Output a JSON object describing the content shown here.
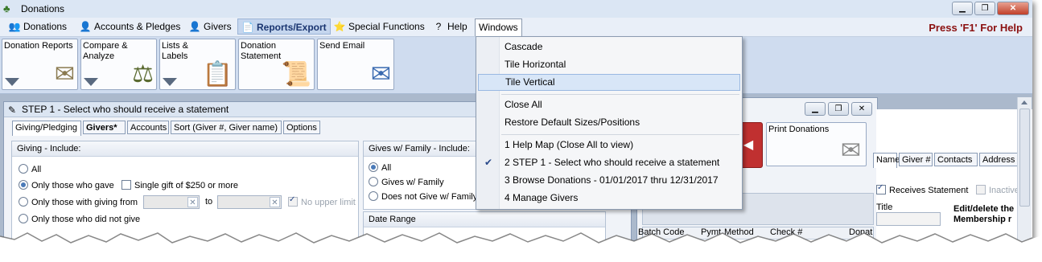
{
  "window": {
    "title": "Donations",
    "buttons": [
      "▁",
      "❐",
      "✕"
    ]
  },
  "menubar": {
    "items": [
      {
        "label": "Donations",
        "icon": "👥"
      },
      {
        "label": "Accounts & Pledges",
        "icon": "👤"
      },
      {
        "label": "Givers",
        "icon": "👤"
      },
      {
        "label": "Reports/Export",
        "icon": "📄"
      },
      {
        "label": "Special Functions",
        "icon": "⭐"
      },
      {
        "label": "Help",
        "icon": "?"
      },
      {
        "label": "Windows",
        "icon": ""
      }
    ],
    "help_hint": "Press 'F1' For Help"
  },
  "toolbar": {
    "buttons": [
      {
        "label": "Donation Reports",
        "art": "✉"
      },
      {
        "label": "Compare & Analyze",
        "art": "⚖"
      },
      {
        "label": "Lists &\nLabels",
        "art": "📋"
      },
      {
        "label": "Donation Statement",
        "art": "📜"
      },
      {
        "label": "Send Email",
        "art": "✉"
      }
    ]
  },
  "step1": {
    "title": "STEP 1 - Select who should receive a statement",
    "tabs": [
      "Giving/Pledging",
      "Givers*",
      "Accounts",
      "Sort (Giver #, Giver name)",
      "Options"
    ],
    "giving_panel": {
      "header": "Giving - Include:",
      "options": [
        "All",
        "Only those who gave",
        "Only those with giving from",
        "Only those who did not give"
      ],
      "single_gift": "Single gift of $250 or more",
      "to_label": "to",
      "no_upper_limit": "No upper limit"
    },
    "family_panel": {
      "header": "Gives w/ Family - Include:",
      "options": [
        "All",
        "Gives w/ Family",
        "Does not Give w/ Family"
      ]
    },
    "date_range_header": "Date Range"
  },
  "browse_window": {
    "print_donations": "Print Donations",
    "tabs": [
      "Name",
      "Giver #",
      "Contacts",
      "Address"
    ],
    "receives_statement": "Receives Statement",
    "inactive": "Inactive",
    "title_label": "Title",
    "edit_text": "Edit/delete the",
    "membership_text": "Membership r",
    "columns": [
      "Batch Code",
      "Pymt",
      "Method",
      "Check #",
      "Donat"
    ]
  },
  "windows_menu": {
    "items": [
      {
        "label": "Cascade",
        "checked": false,
        "highlighted": false
      },
      {
        "label": "Tile Horizontal",
        "checked": false,
        "highlighted": false
      },
      {
        "label": "Tile Vertical",
        "checked": false,
        "highlighted": true
      },
      {
        "label": "Close All",
        "checked": false,
        "highlighted": false
      },
      {
        "label": "Restore Default Sizes/Positions",
        "checked": false,
        "highlighted": false
      },
      {
        "label": "1 Help Map (Close All to view)",
        "checked": false,
        "highlighted": false
      },
      {
        "label": "2 STEP 1 - Select who should receive a statement",
        "checked": true,
        "highlighted": false
      },
      {
        "label": "3 Browse Donations - 01/01/2017 thru 12/31/2017",
        "checked": false,
        "highlighted": false
      },
      {
        "label": "4 Manage Givers",
        "checked": false,
        "highlighted": false
      }
    ]
  }
}
